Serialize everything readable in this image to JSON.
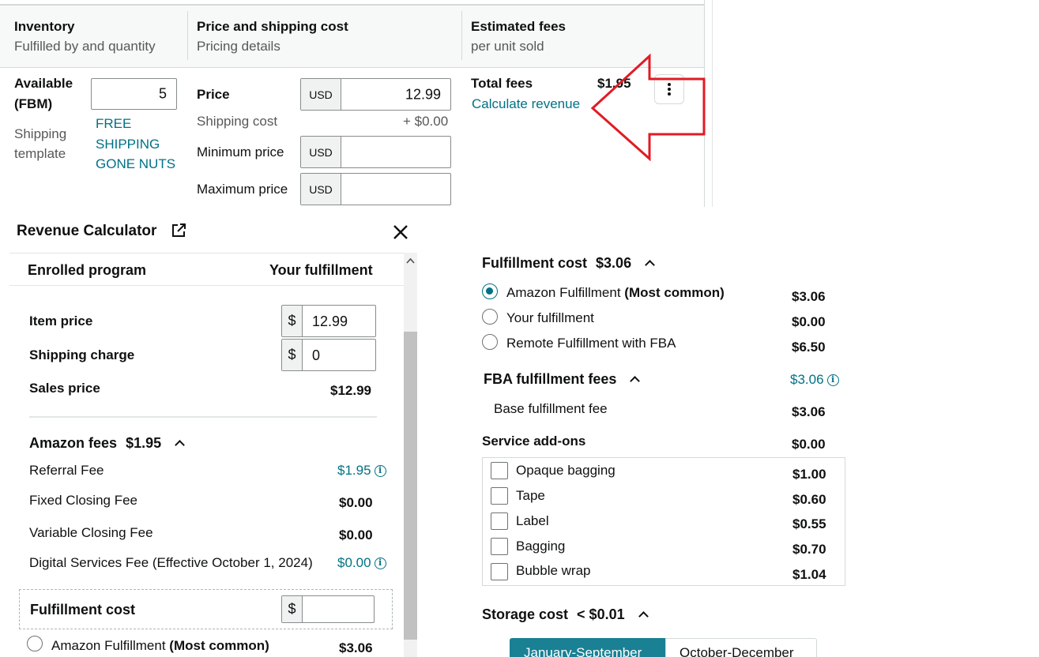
{
  "table": {
    "headers": [
      {
        "title": "Inventory",
        "subtitle": "Fulfilled by and quantity"
      },
      {
        "title": "Price and shipping cost",
        "subtitle": "Pricing details"
      },
      {
        "title": "Estimated fees",
        "subtitle": "per unit sold"
      }
    ],
    "available_label_1": "Available",
    "available_label_2": "(FBM)",
    "quantity": "5",
    "shipping_template_label_1": "Shipping",
    "shipping_template_label_2": "template",
    "shipping_template_value_1": "FREE",
    "shipping_template_value_2": "SHIPPING",
    "shipping_template_value_3": "GONE NUTS",
    "price_label": "Price",
    "currency": "USD",
    "price_value": "12.99",
    "shipping_cost_label": "Shipping cost",
    "shipping_cost_value": "+ $0.00",
    "min_price_label": "Minimum price",
    "max_price_label": "Maximum price",
    "total_fees_label": "Total fees",
    "total_fees_value": "$1.95",
    "calculate_revenue": "Calculate revenue",
    "more_icon": "vertical-ellipsis-icon",
    "annotation": {
      "shape": "red-arrow-left",
      "color": "#e01b24"
    }
  },
  "calculator": {
    "title": "Revenue Calculator",
    "external_icon": "external-link-icon",
    "close_icon": "close-icon",
    "col_enrolled": "Enrolled program",
    "col_yours": "Your fulfillment",
    "item_price_label": "Item price",
    "item_price_value": "12.99",
    "currency_symbol": "$",
    "shipping_charge_label": "Shipping charge",
    "shipping_charge_value": "0",
    "sales_price_label": "Sales price",
    "sales_price_value": "$12.99",
    "amazon_fees_title": "Amazon fees",
    "amazon_fees_value": "$1.95",
    "referral_fee_label": "Referral Fee",
    "referral_fee_value": "$1.95",
    "fixed_closing_label": "Fixed Closing Fee",
    "fixed_closing_value": "$0.00",
    "variable_closing_label": "Variable Closing Fee",
    "variable_closing_value": "$0.00",
    "digital_services_label": "Digital Services Fee (Effective October 1, 2024)",
    "digital_services_value": "$0.00",
    "fulfillment_cost_label": "Fulfillment cost",
    "amazon_fulfillment_label": "Amazon Fulfillment",
    "most_common": "(Most common)",
    "amazon_fulfillment_value": "$3.06"
  },
  "fulfillment": {
    "title": "Fulfillment cost",
    "value": "$3.06",
    "options": [
      {
        "label": "Amazon Fulfillment",
        "tag": "(Most common)",
        "value": "$3.06",
        "selected": true
      },
      {
        "label": "Your fulfillment",
        "tag": "",
        "value": "$0.00",
        "selected": false
      },
      {
        "label": "Remote Fulfillment with FBA",
        "tag": "",
        "value": "$6.50",
        "selected": false
      }
    ],
    "fba_title": "FBA fulfillment fees",
    "fba_value": "$3.06",
    "base_fee_label": "Base fulfillment fee",
    "base_fee_value": "$3.06",
    "addons_title": "Service add-ons",
    "addons_value": "$0.00",
    "addons": [
      {
        "label": "Opaque bagging",
        "value": "$1.00"
      },
      {
        "label": "Tape",
        "value": "$0.60"
      },
      {
        "label": "Label",
        "value": "$0.55"
      },
      {
        "label": "Bagging",
        "value": "$0.70"
      },
      {
        "label": "Bubble wrap",
        "value": "$1.04"
      }
    ],
    "storage_title": "Storage cost",
    "storage_value": "< $0.01",
    "storage_tabs": [
      "January-September",
      "October-December"
    ]
  }
}
